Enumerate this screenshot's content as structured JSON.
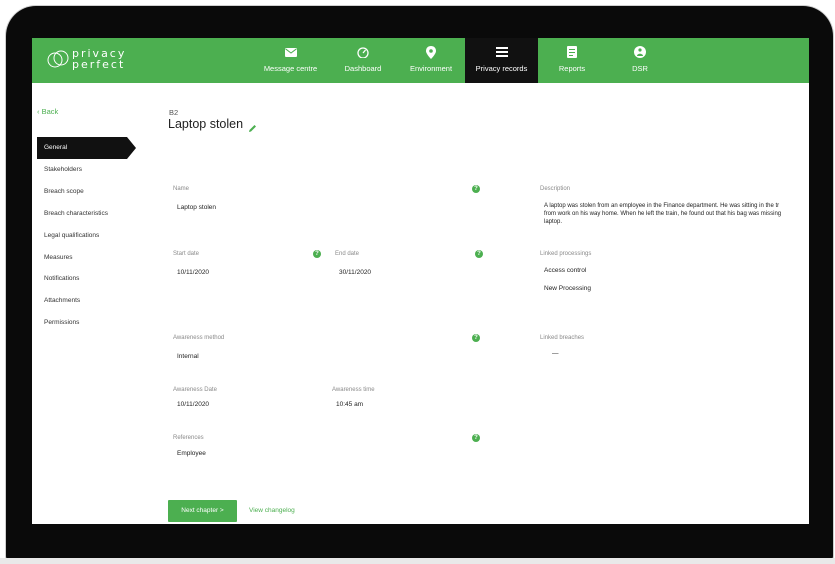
{
  "app": {
    "logo_text_line1": "privacy",
    "logo_text_line2": "perfect"
  },
  "nav": [
    {
      "label": "Message centre",
      "icon": "envelope-icon"
    },
    {
      "label": "Dashboard",
      "icon": "gauge-icon"
    },
    {
      "label": "Environment",
      "icon": "location-pin-icon"
    },
    {
      "label": "Privacy records",
      "icon": "list-icon",
      "active": true
    },
    {
      "label": "Reports",
      "icon": "document-icon"
    },
    {
      "label": "DSR",
      "icon": "person-circle-icon"
    }
  ],
  "sidebar": {
    "back_label": "‹ Back",
    "items": [
      {
        "label": "General",
        "active": true
      },
      {
        "label": "Stakeholders"
      },
      {
        "label": "Breach scope"
      },
      {
        "label": "Breach characteristics"
      },
      {
        "label": "Legal qualifications"
      },
      {
        "label": "Measures"
      },
      {
        "label": "Notifications"
      },
      {
        "label": "Attachments"
      },
      {
        "label": "Permissions"
      }
    ]
  },
  "record": {
    "number": "B2",
    "title": "Laptop stolen"
  },
  "fields": {
    "name": {
      "label": "Name",
      "value": "Laptop stolen"
    },
    "start_date": {
      "label": "Start date",
      "value": "10/11/2020"
    },
    "end_date": {
      "label": "End date",
      "value": "30/11/2020"
    },
    "awareness_method": {
      "label": "Awareness method",
      "value": "Internal"
    },
    "awareness_date": {
      "label": "Awareness Date",
      "value": "10/11/2020"
    },
    "awareness_time": {
      "label": "Awareness time",
      "value": "10:45 am"
    },
    "references": {
      "label": "References",
      "value": "Employee"
    },
    "description": {
      "label": "Description",
      "lines": [
        "A laptop was stolen from an employee in the Finance department. He was sitting in the tr",
        "from work on his way home. When he left the train, he found out that his bag was missing",
        "laptop."
      ]
    },
    "linked_processings": {
      "label": "Linked processings",
      "values": [
        "Access control",
        "New Processing"
      ]
    },
    "linked_breaches": {
      "label": "Linked breaches",
      "value": "—"
    }
  },
  "actions": {
    "next_label": "Next chapter >",
    "changelog_label": "View changelog"
  },
  "colors": {
    "brand_green": "#4caf50",
    "active_dark": "#111111"
  }
}
